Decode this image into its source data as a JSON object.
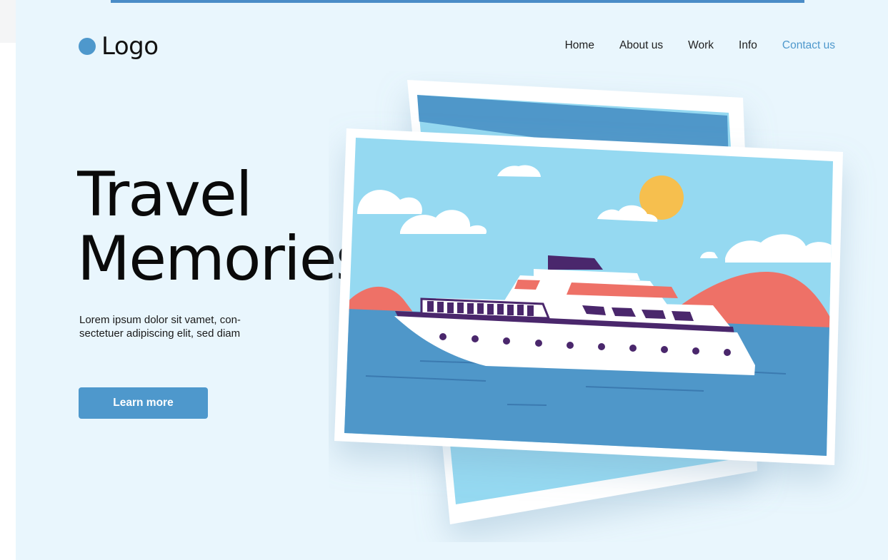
{
  "brand": {
    "logo_text": "Logo",
    "accent_color": "#4e98cc"
  },
  "nav": {
    "items": [
      {
        "label": "Home"
      },
      {
        "label": "About us"
      },
      {
        "label": "Work"
      },
      {
        "label": "Info"
      },
      {
        "label": "Contact us",
        "active": true
      }
    ]
  },
  "hero": {
    "title_line1": "Travel",
    "title_line2": "Memories",
    "description": "Lorem ipsum dolor sit vamet, con- sectetuer adipiscing elit, sed diam",
    "cta_label": "Learn more"
  },
  "illustration": {
    "subject": "cruise-ship-photo-stack",
    "colors": {
      "sky": "#95d9f1",
      "sea": "#4f97c9",
      "hills": "#ee7167",
      "sun": "#f6bf4e",
      "ship_accent": "#4a276c",
      "ship_red": "#ee7167"
    }
  }
}
